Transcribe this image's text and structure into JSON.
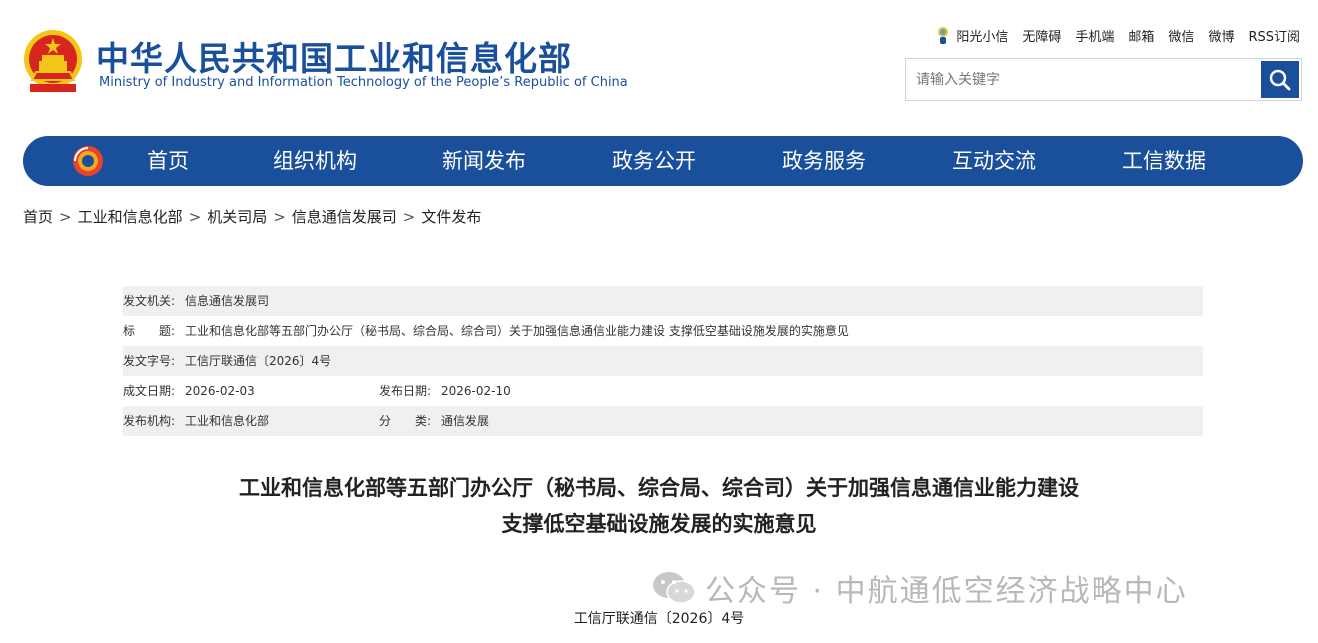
{
  "header": {
    "title_cn": "中华人民共和国工业和信息化部",
    "title_en": "Ministry of Industry and Information Technology of the People’s Republic of China",
    "toplinks": [
      "阳光小信",
      "无障碍",
      "手机端",
      "邮箱",
      "微信",
      "微博",
      "RSS订阅"
    ],
    "search_placeholder": "请输入关键字"
  },
  "nav": {
    "items": [
      "首页",
      "组织机构",
      "新闻发布",
      "政务公开",
      "政务服务",
      "互动交流",
      "工信数据"
    ]
  },
  "breadcrumb": [
    "首页",
    "工业和信息化部",
    "机关司局",
    "信息通信发展司",
    "文件发布"
  ],
  "meta": {
    "issuer_label": "发文机关:",
    "issuer": "信息通信发展司",
    "title_label": "标　　题:",
    "title": "工业和信息化部等五部门办公厅（秘书局、综合局、综合司）关于加强信息通信业能力建设 支撑低空基础设施发展的实施意见",
    "docno_label": "发文字号:",
    "docno": "工信厅联通信〔2026〕4号",
    "written_label": "成文日期:",
    "written": "2026-02-03",
    "published_label": "发布日期:",
    "published": "2026-02-10",
    "org_label": "发布机构:",
    "org": "工业和信息化部",
    "category_label": "分　　类:",
    "category": "通信发展"
  },
  "document": {
    "title_line1": "工业和信息化部等五部门办公厅（秘书局、综合局、综合司）关于加强信息通信业能力建设",
    "title_line2": "支撑低空基础设施发展的实施意见",
    "number": "工信厅联通信〔2026〕4号"
  },
  "watermark": {
    "text": "公众号 · 中航通低空经济战略中心"
  },
  "colors": {
    "brand_blue": "#1a4f9c",
    "meta_row_gray": "#f0f0f0",
    "emblem_red": "#d7261e",
    "emblem_gold": "#f5c518"
  }
}
